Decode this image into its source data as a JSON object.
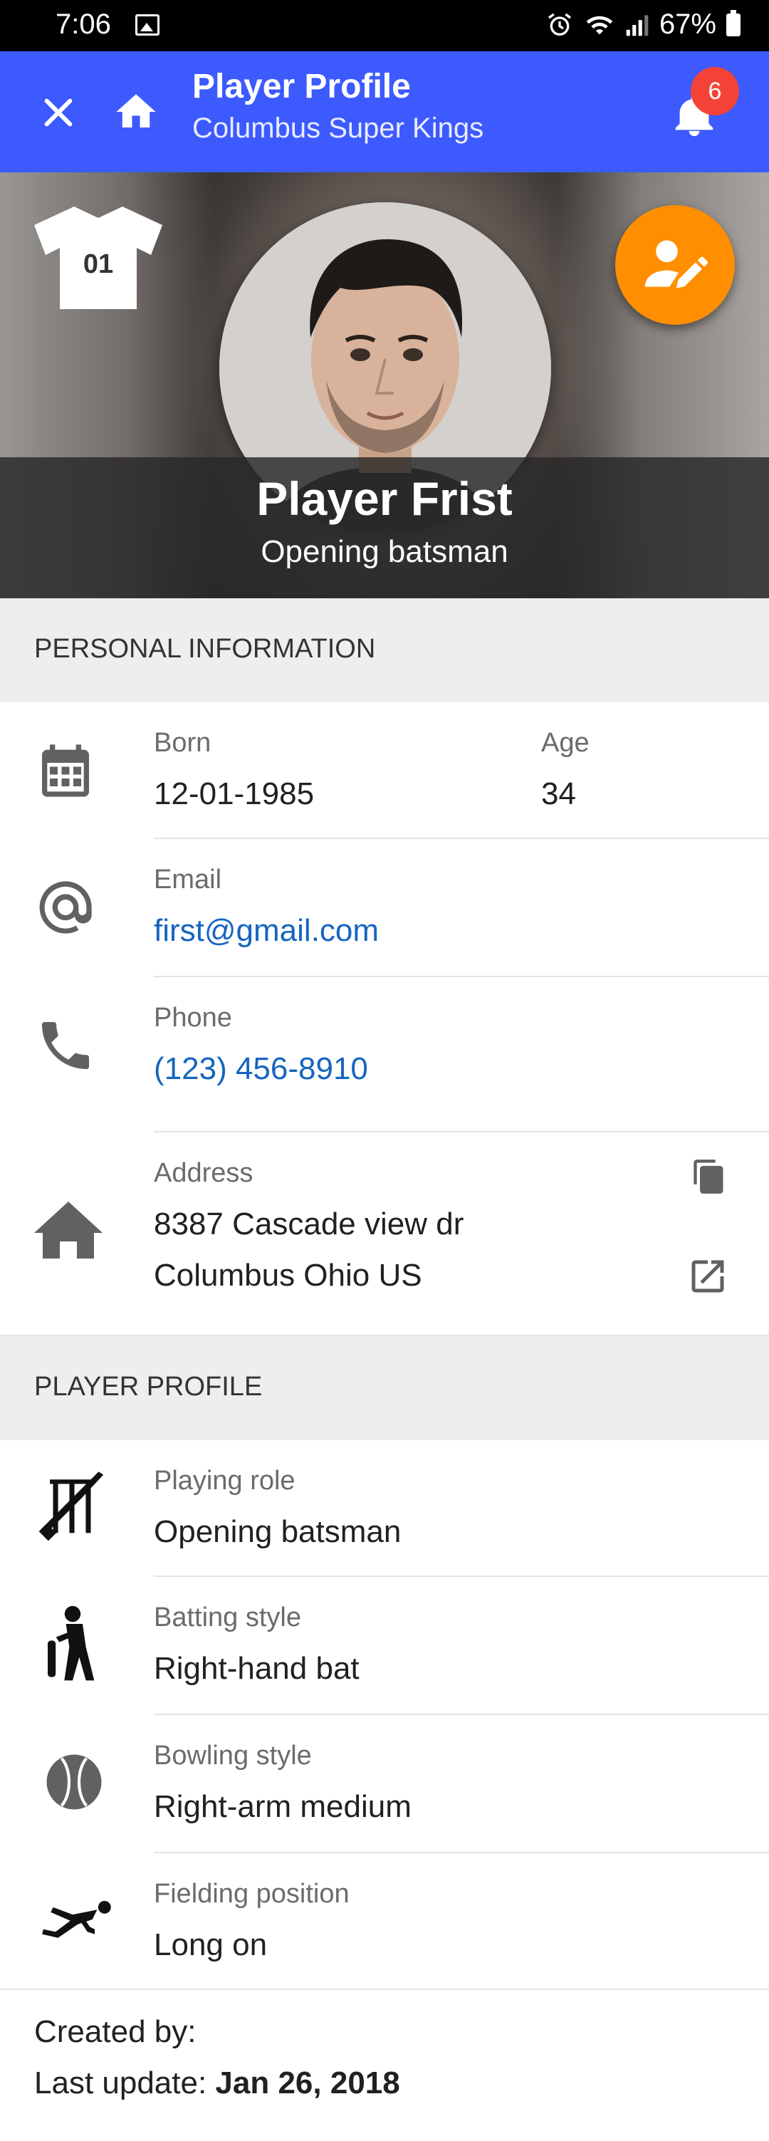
{
  "status_bar": {
    "time": "7:06",
    "battery": "67%"
  },
  "app_bar": {
    "title": "Player Profile",
    "subtitle": "Columbus Super Kings",
    "notification_count": "6"
  },
  "hero": {
    "jersey_number": "01",
    "name": "Player Frist",
    "role": "Opening batsman"
  },
  "personal": {
    "header": "PERSONAL INFORMATION",
    "born_label": "Born",
    "born_value": "12-01-1985",
    "age_label": "Age",
    "age_value": "34",
    "email_label": "Email",
    "email_value": "first@gmail.com",
    "phone_label": "Phone",
    "phone_value": "(123) 456-8910",
    "address_label": "Address",
    "address_line1": "8387 Cascade view dr",
    "address_line2": "Columbus Ohio US"
  },
  "profile": {
    "header": "PLAYER PROFILE",
    "playing_role_label": "Playing role",
    "playing_role_value": "Opening batsman",
    "batting_label": "Batting style",
    "batting_value": "Right-hand bat",
    "bowling_label": "Bowling style",
    "bowling_value": "Right-arm medium",
    "fielding_label": "Fielding position",
    "fielding_value": "Long on"
  },
  "footer": {
    "created_by": "Created by:",
    "last_update_label": "Last update:",
    "last_update_value": "Jan 26, 2018"
  },
  "icons": [
    "close-icon",
    "home-icon",
    "bell-icon",
    "jersey-icon",
    "edit-person-icon",
    "calendar-icon",
    "at-icon",
    "phone-icon",
    "home-icon",
    "copy-icon",
    "open-external-icon",
    "cricket-stumps-icon",
    "batsman-icon",
    "ball-icon",
    "fielder-icon"
  ],
  "colors": {
    "app_bar": "#3d5afe",
    "fab": "#ff8f00",
    "badge": "#f44336",
    "link": "#1565c0"
  }
}
